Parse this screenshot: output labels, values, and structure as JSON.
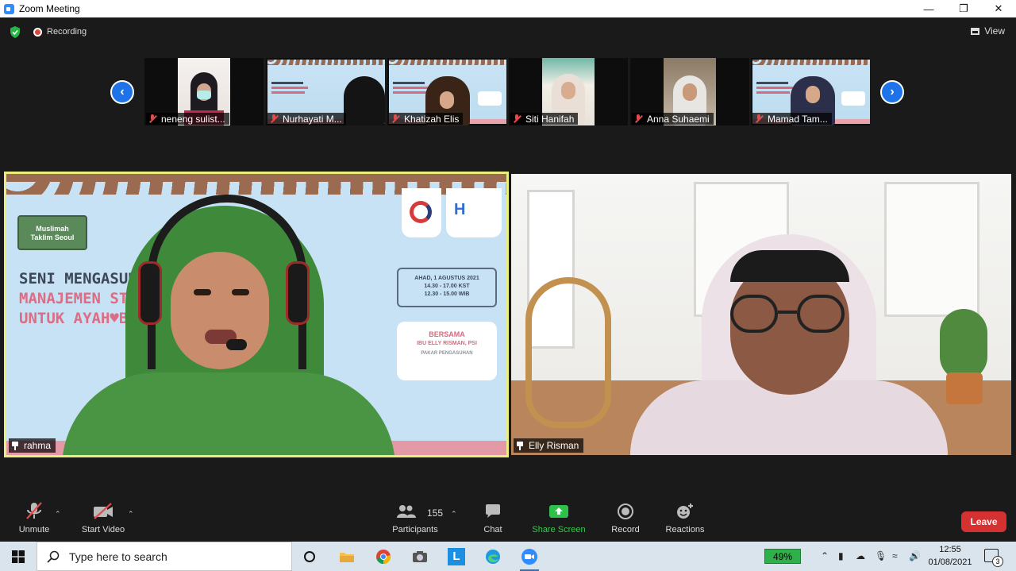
{
  "window": {
    "title": "Zoom Meeting"
  },
  "topbar": {
    "recording_label": "Recording",
    "view_label": "View"
  },
  "participants_strip": [
    {
      "name": "neneng sulist..."
    },
    {
      "name": "Nurhayati M..."
    },
    {
      "name": "Khatizah Elis"
    },
    {
      "name": "Siti Hanifah"
    },
    {
      "name": "Anna Suhaemi"
    },
    {
      "name": "Mamad Tam..."
    }
  ],
  "main_videos": {
    "left": {
      "name": "rahma"
    },
    "right": {
      "name": "Elly Risman"
    }
  },
  "slide": {
    "badge_line1": "Muslimah",
    "badge_line2": "Taklim Seoul",
    "title_line1": "SENI MENGASUH",
    "title_line2": "MANAJEMEN STRES",
    "title_line3": "UNTUK AYAH♥BUNDA",
    "date_line1": "AHAD, 1 AGUSTUS 2021",
    "date_line2": "14.30 - 17.00 KST",
    "date_line3": "12.30 - 15.00 WIB",
    "with_label": "BERSAMA",
    "speaker": "IBU ELLY RISMAN, PSI",
    "speaker_sub": "PAKAR PENGASUHAN"
  },
  "toolbar": {
    "unmute_label": "Unmute",
    "start_video_label": "Start Video",
    "participants_count": "155",
    "participants_label": "Participants",
    "chat_label": "Chat",
    "share_label": "Share Screen",
    "record_label": "Record",
    "reactions_label": "Reactions",
    "leave_label": "Leave"
  },
  "taskbar": {
    "search_placeholder": "Type here to search",
    "battery": "49%",
    "time": "12:55",
    "date": "01/08/2021",
    "notification_count": "3"
  },
  "colors": {
    "accent_blue": "#1e73e8",
    "leave_red": "#d63131",
    "share_green": "#35c84b",
    "active_speaker_border": "#e9ee7e"
  }
}
